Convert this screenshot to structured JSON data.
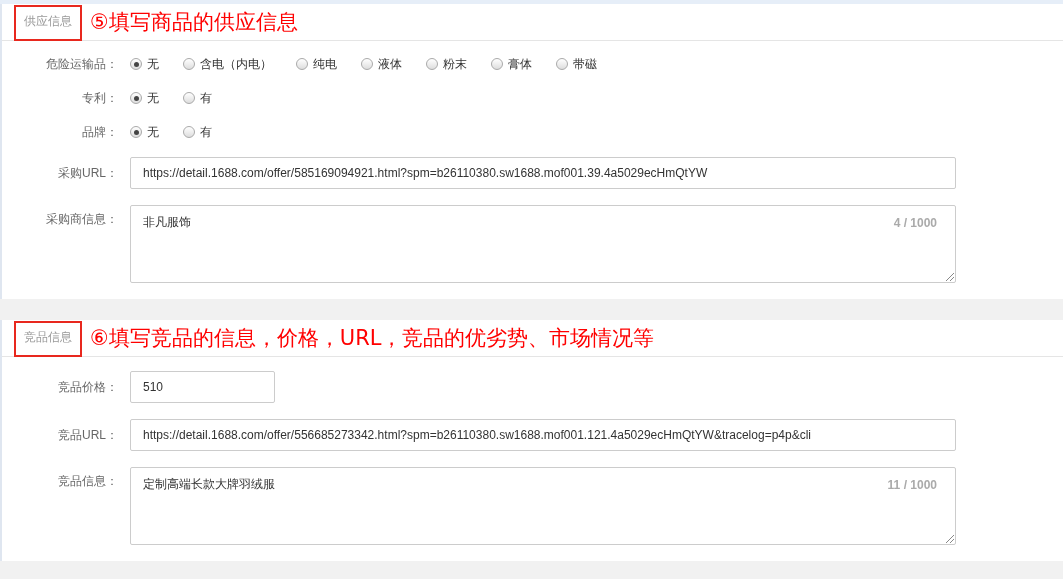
{
  "sections": [
    {
      "title": "供应信息",
      "annotation": "⑤填写商品的供应信息",
      "fields": [
        {
          "kind": "radio",
          "label": "危险运输品：",
          "options": [
            {
              "label": "无",
              "selected": true
            },
            {
              "label": "含电（内电）",
              "selected": false
            },
            {
              "label": "纯电",
              "selected": false
            },
            {
              "label": "液体",
              "selected": false
            },
            {
              "label": "粉末",
              "selected": false
            },
            {
              "label": "膏体",
              "selected": false
            },
            {
              "label": "带磁",
              "selected": false
            }
          ]
        },
        {
          "kind": "radio",
          "label": "专利：",
          "options": [
            {
              "label": "无",
              "selected": true
            },
            {
              "label": "有",
              "selected": false
            }
          ]
        },
        {
          "kind": "radio",
          "label": "品牌：",
          "options": [
            {
              "label": "无",
              "selected": true
            },
            {
              "label": "有",
              "selected": false
            }
          ]
        },
        {
          "kind": "text",
          "label": "采购URL：",
          "value": "https://detail.1688.com/offer/585169094921.html?spm=b26110380.sw1688.mof001.39.4a5029ecHmQtYW"
        },
        {
          "kind": "textarea",
          "label": "采购商信息：",
          "value": "非凡服饰",
          "counter": "4 / 1000"
        }
      ]
    },
    {
      "title": "竞品信息",
      "annotation": "⑥填写竞品的信息，价格，URL，竞品的优劣势、市场情况等",
      "fields": [
        {
          "kind": "short",
          "label": "竞品价格：",
          "value": "510"
        },
        {
          "kind": "text",
          "label": "竞品URL：",
          "value": "https://detail.1688.com/offer/556685273342.html?spm=b26110380.sw1688.mof001.121.4a5029ecHmQtYW&tracelog=p4p&cli"
        },
        {
          "kind": "textarea",
          "label": "竞品信息：",
          "value": "定制高端长款大牌羽绒服",
          "counter": "11 / 1000"
        }
      ]
    }
  ]
}
